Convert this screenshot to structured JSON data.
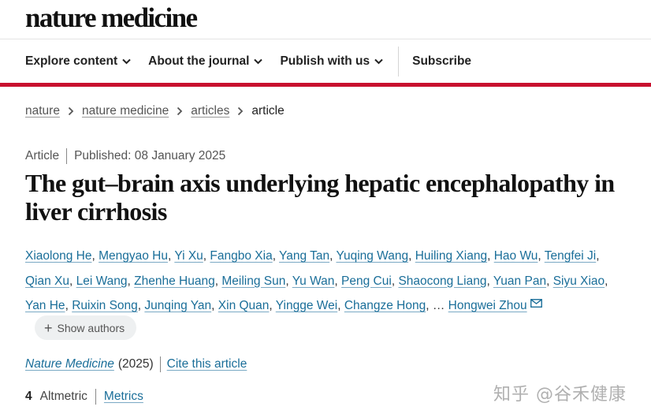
{
  "brand": {
    "logo_text": "nature medicine",
    "accent_color": "#c8102e",
    "link_color": "#1a6e99"
  },
  "nav": {
    "items": [
      {
        "label": "Explore content",
        "has_dropdown": true,
        "icon": "chevron-down-icon"
      },
      {
        "label": "About the journal",
        "has_dropdown": true,
        "icon": "chevron-down-icon"
      },
      {
        "label": "Publish with us",
        "has_dropdown": true,
        "icon": "chevron-down-icon"
      }
    ],
    "subscribe": "Subscribe"
  },
  "breadcrumb": [
    "nature",
    "nature medicine",
    "articles",
    "article"
  ],
  "article": {
    "type": "Article",
    "published": "Published: 08 January 2025",
    "title": "The gut–brain axis underlying hepatic encephalopathy in liver cirrhosis",
    "authors": [
      "Xiaolong He",
      "Mengyao Hu",
      "Yi Xu",
      "Fangbo Xia",
      "Yang Tan",
      "Yuqing Wang",
      "Huiling Xiang",
      "Hao Wu",
      "Tengfei Ji",
      "Qian Xu",
      "Lei Wang",
      "Zhenhe Huang",
      "Meiling Sun",
      "Yu Wan",
      "Peng Cui",
      "Shaocong Liang",
      "Yuan Pan",
      "Siyu Xiao",
      "Yan He",
      "Ruixin Song",
      "Junqing Yan",
      "Xin Quan",
      "Yingge Wei",
      "Changze Hong"
    ],
    "ellipsis": "…",
    "last_author": "Hongwei Zhou",
    "show_authors": "Show authors",
    "journal_name": "Nature Medicine",
    "year": "(2025)",
    "cite": "Cite this article",
    "altmetric_count": "4",
    "altmetric_label": "Altmetric",
    "metrics_link": "Metrics"
  },
  "watermark": "知乎 @谷禾健康"
}
